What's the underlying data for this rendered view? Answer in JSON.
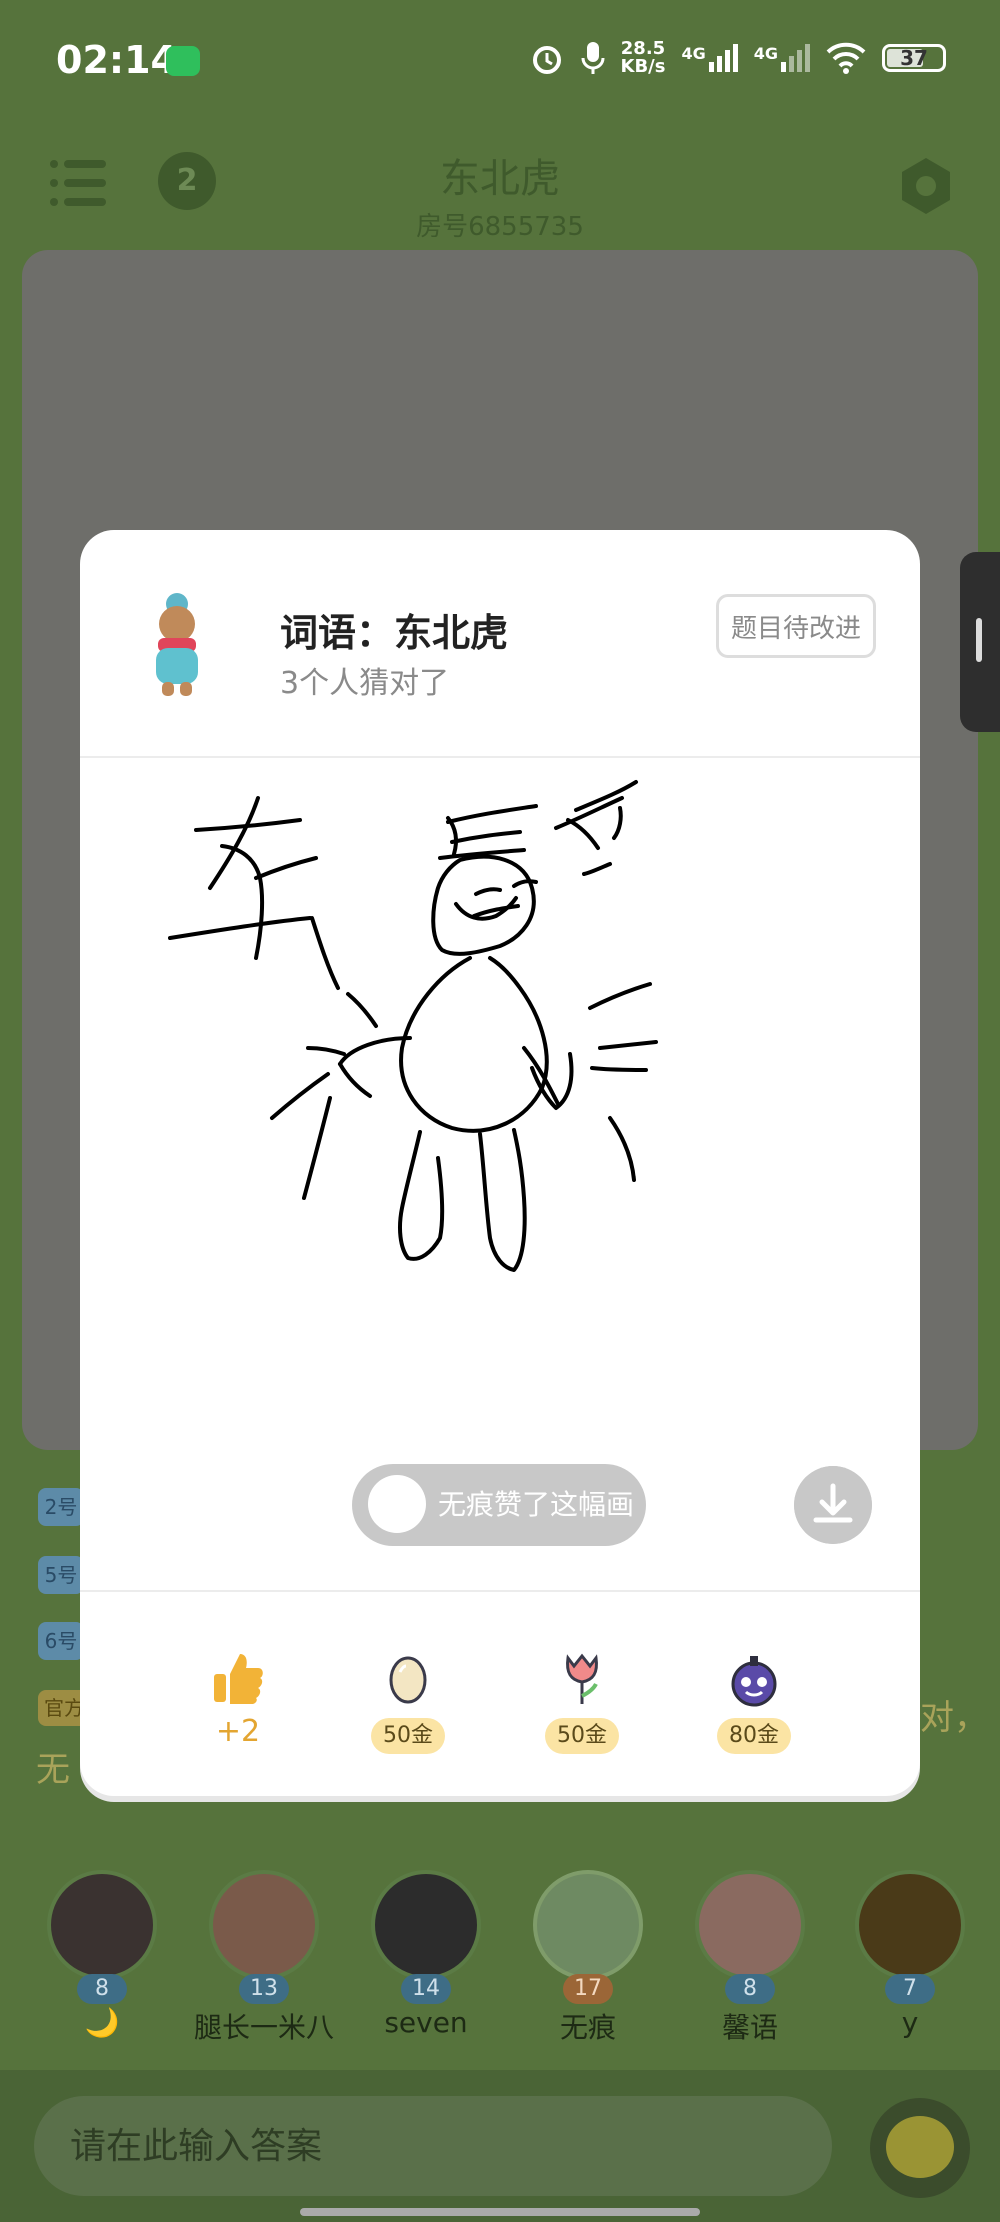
{
  "status_bar": {
    "time": "02:14",
    "net_speed_value": "28.5",
    "net_speed_unit": "KB/s",
    "sim1": "4G",
    "sim2": "4G",
    "battery": "37"
  },
  "header": {
    "alarm_count": "2",
    "title": "东北虎",
    "room": "房号6855735"
  },
  "chat": {
    "tags": [
      "2号",
      "5号",
      "6号"
    ],
    "official_tag": "官方",
    "ghost_left": "无",
    "ghost_right": "对，"
  },
  "modal": {
    "word": "词语：东北虎",
    "guessed": "3个人猜对了",
    "improve_button": "题目待改进",
    "like_text": "无痕赞了这幅画",
    "thumb_count": "+2",
    "gifts": [
      {
        "name": "egg",
        "price": "50金"
      },
      {
        "name": "flower",
        "price": "50金"
      },
      {
        "name": "bomb",
        "price": "80金"
      }
    ]
  },
  "players": [
    {
      "level": "8",
      "name": "🌙"
    },
    {
      "level": "13",
      "name": "腿长一米八"
    },
    {
      "level": "14",
      "name": "seven"
    },
    {
      "level": "17",
      "name": "无痕"
    },
    {
      "level": "8",
      "name": "馨语"
    },
    {
      "level": "7",
      "name": "y"
    }
  ],
  "input": {
    "placeholder": "请在此输入答案"
  },
  "colors": {
    "accent_gold": "#e3a531",
    "price_bg": "#fbe4a4",
    "bg_green": "#56733c"
  }
}
